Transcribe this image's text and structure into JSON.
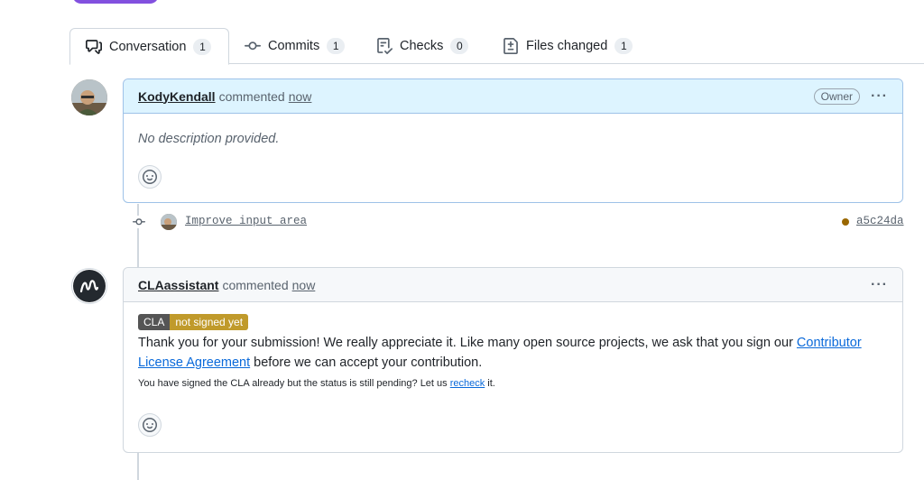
{
  "tabs": [
    {
      "label": "Conversation",
      "count": "1",
      "icon": "comment-discussion-icon"
    },
    {
      "label": "Commits",
      "count": "1",
      "icon": "git-commit-icon"
    },
    {
      "label": "Checks",
      "count": "0",
      "icon": "checklist-icon"
    },
    {
      "label": "Files changed",
      "count": "1",
      "icon": "file-diff-icon"
    }
  ],
  "comments": [
    {
      "author": "KodyKendall",
      "action": "commented",
      "time": "now",
      "badge": "Owner",
      "body": "No description provided."
    },
    {
      "author": "CLAassistant",
      "action": "commented",
      "time": "now",
      "cla_badge_left": "CLA",
      "cla_badge_right": "not signed yet",
      "body_part1": "Thank you for your submission! We really appreciate it. Like many open source projects, we ask that you sign our ",
      "body_link": "Contributor License Agreement",
      "body_part2": " before we can accept your contribution.",
      "small_part1": "You have signed the CLA already but the status is still pending? Let us ",
      "small_link": "recheck",
      "small_part2": " it."
    }
  ],
  "commit": {
    "message": "Improve input area",
    "sha": "a5c24da",
    "status_color": "#9a6700"
  },
  "colors": {
    "accent": "#8250df",
    "link": "#0969da",
    "owner_header_bg": "#ddf4ff"
  }
}
